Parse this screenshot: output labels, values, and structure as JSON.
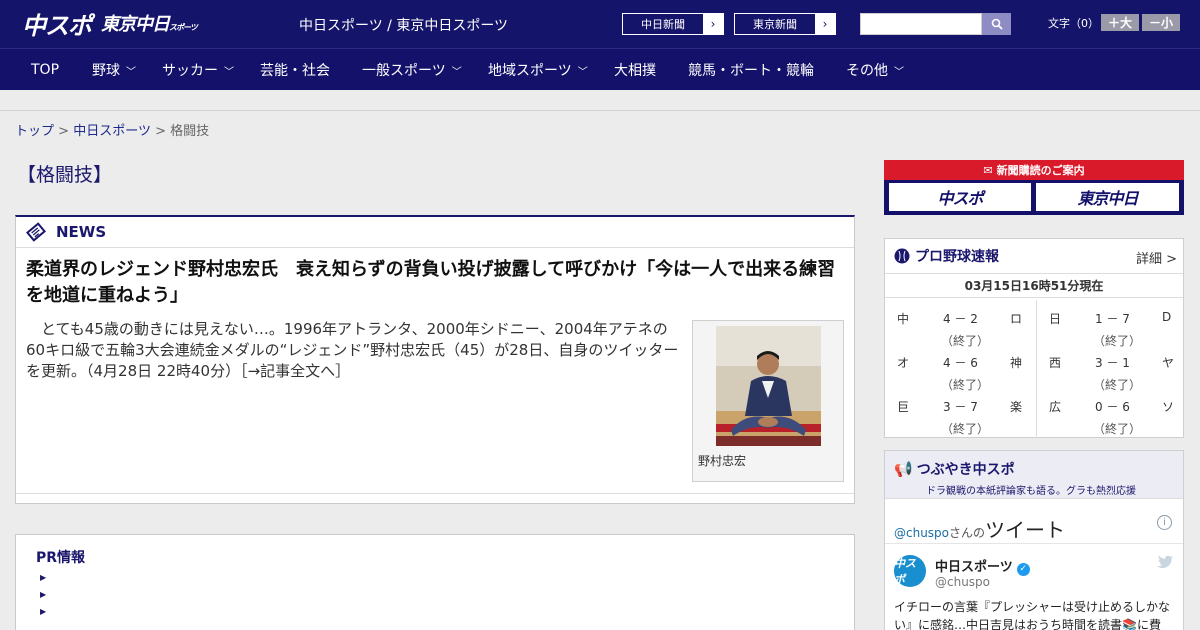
{
  "header": {
    "logo_main": "中スポ",
    "logo_sub": "東京中日",
    "logo_sub_small": "スポーツ",
    "site_links": "中日スポーツ / 東京中日スポーツ",
    "paper_buttons": [
      "中日新聞",
      "東京新聞"
    ],
    "font_size_label": "文字（0）",
    "font_plus": "＋大",
    "font_minus": "－小"
  },
  "nav": {
    "items": [
      "TOP",
      "野球",
      "サッカー",
      "芸能・社会",
      "一般スポーツ",
      "地域スポーツ",
      "大相撲",
      "競馬・ボート・競輪",
      "その他"
    ]
  },
  "breadcrumb": {
    "home": "トップ",
    "section": "中日スポーツ",
    "current": "格闘技",
    "sep": ">"
  },
  "page": {
    "title": "【格闘技】"
  },
  "news": {
    "label": "NEWS",
    "headline": "柔道界のレジェンド野村忠宏氏　衰え知らずの背負い投げ披露して呼びかけ「今は一人で出来る練習を地道に重ねよう」",
    "lead": "とても45歳の動きには見えない…。1996年アトランタ、2000年シドニー、2004年アテネの60キロ級で五輪3大会連続金メダルの“レジェンド”野村忠宏氏（45）が28日、自身のツイッターを更新。（4月28日 22時40分）［→記事全文へ］",
    "photo_caption": "野村忠宏"
  },
  "pr": {
    "title": "PR情報"
  },
  "subscription": {
    "banner": "新聞購読のご案内",
    "btn1": "中スポ",
    "btn2": "東京中日"
  },
  "baseball": {
    "title": "プロ野球速報",
    "detail": "詳細 >",
    "time": "03月15日16時51分現在",
    "left_games": [
      {
        "t1": "中",
        "score": "4 － 2",
        "t2": "ロ",
        "status": "（終了）"
      },
      {
        "t1": "オ",
        "score": "4 － 6",
        "t2": "神",
        "status": "（終了）"
      },
      {
        "t1": "巨",
        "score": "3 － 7",
        "t2": "楽",
        "status": "（終了）"
      }
    ],
    "right_games": [
      {
        "t1": "日",
        "score": "1 － 7",
        "t2": "D",
        "status": "（終了）"
      },
      {
        "t1": "西",
        "score": "3 － 1",
        "t2": "ヤ",
        "status": "（終了）"
      },
      {
        "t1": "広",
        "score": "0 － 6",
        "t2": "ソ",
        "status": "（終了）"
      }
    ]
  },
  "tweets": {
    "title": "つぶやき中スポ",
    "subtitle": "ドラ観戦の本紙評論家も語る。グラも熱烈応援",
    "user_handle_link": "@chuspo",
    "user_suffix": "さんの",
    "heading": "ツイート",
    "author_name": "中日スポーツ",
    "author_handle": "@chuspo",
    "avatar_text": "中スポ",
    "text": "イチローの言葉『プレッシャーは受け止めるしかない』に感銘…中日吉見はおうち時間を読書📚に費"
  },
  "colors": {
    "navy": "#15146b",
    "red": "#d91a2a",
    "twitter_blue": "#1d9bf0"
  }
}
